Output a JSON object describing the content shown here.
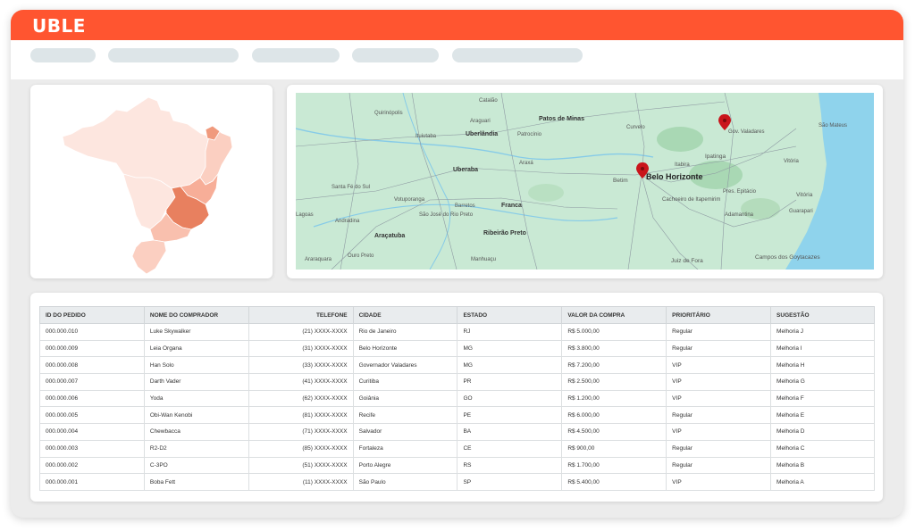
{
  "app": {
    "brand": "UBLE",
    "accent": "#ff5530"
  },
  "nav": {
    "placeholder_pills": 5
  },
  "brazil_map": {
    "highlight_state": "MG",
    "colors": {
      "base": "#fde6df",
      "light": "#fbcfc1",
      "medium": "#f7ae98",
      "strong": "#e8805f"
    }
  },
  "map": {
    "markers": [
      {
        "city": "Belo Horizonte",
        "icon": "map-pin-icon"
      },
      {
        "city": "Gov. Valadares",
        "icon": "map-pin-icon"
      }
    ],
    "major_labels": [
      "Belo Horizonte",
      "Uberlândia",
      "Uberaba",
      "Patos de Minas",
      "Ribeirão Preto",
      "Franca",
      "Araçatuba",
      "Ipatinga",
      "Betim",
      "Colatina",
      "Vitória",
      "Guarapari",
      "São Mateus",
      "Juiz de Fora",
      "Campos dos Goytacazes"
    ],
    "minor_labels": [
      "Catalão",
      "Quirinópolis",
      "Araguari",
      "Ituiutaba",
      "Patrocínio",
      "Curvelo",
      "Gov. Valadares",
      "Araxá",
      "Itabira",
      "Santa Fé do Sul",
      "Votuporanga",
      "Barretos",
      "São José do Rio Preto",
      "Andradina",
      "Ouro Preto",
      "Manhuaçu",
      "Cachoeiro de Itapemirim",
      "Pres. Epitácio",
      "Adamantina",
      "Araraquara",
      "Lagoas"
    ],
    "colors": {
      "land": "#c9e9d4",
      "water": "#8fd3ec",
      "marker": "#c9151b"
    }
  },
  "table": {
    "headers": [
      "ID DO PEDIDO",
      "NOME DO COMPRADOR",
      "TELEFONE",
      "CIDADE",
      "ESTADO",
      "VALOR DA COMPRA",
      "PRIORITÁRIO",
      "SUGESTÃO"
    ],
    "rows": [
      [
        "000.000.010",
        "Luke Skywalker",
        "(21) XXXX-XXXX",
        "Rio de Janeiro",
        "RJ",
        "R$ 5.000,00",
        "Regular",
        "Melhoria J"
      ],
      [
        "000.000.009",
        "Leia Organa",
        "(31) XXXX-XXXX",
        "Belo Horizonte",
        "MG",
        "R$ 3.800,00",
        "Regular",
        "Melhoria I"
      ],
      [
        "000.000.008",
        "Han Solo",
        "(33) XXXX-XXXX",
        "Governador Valadares",
        "MG",
        "R$ 7.200,00",
        "VIP",
        "Melhoria H"
      ],
      [
        "000.000.007",
        "Darth Vader",
        "(41) XXXX-XXXX",
        "Curitiba",
        "PR",
        "R$ 2.500,00",
        "VIP",
        "Melhoria G"
      ],
      [
        "000.000.006",
        "Yoda",
        "(62) XXXX-XXXX",
        "Goiânia",
        "GO",
        "R$ 1.200,00",
        "VIP",
        "Melhoria F"
      ],
      [
        "000.000.005",
        "Obi-Wan Kenobi",
        "(81) XXXX-XXXX",
        "Recife",
        "PE",
        "R$ 6.000,00",
        "Regular",
        "Melhoria E"
      ],
      [
        "000.000.004",
        "Chewbacca",
        "(71) XXXX-XXXX",
        "Salvador",
        "BA",
        "R$ 4.500,00",
        "VIP",
        "Melhoria D"
      ],
      [
        "000.000.003",
        "R2-D2",
        "(85) XXXX-XXXX",
        "Fortaleza",
        "CE",
        "R$ 900,00",
        "Regular",
        "Melhoria C"
      ],
      [
        "000.000.002",
        "C-3PO",
        "(51) XXXX-XXXX",
        "Porto Alegre",
        "RS",
        "R$ 1.700,00",
        "Regular",
        "Melhoria B"
      ],
      [
        "000.000.001",
        "Boba Fett",
        "(11) XXXX-XXXX",
        "São Paulo",
        "SP",
        "R$ 5.400,00",
        "VIP",
        "Melhoria A"
      ]
    ]
  }
}
